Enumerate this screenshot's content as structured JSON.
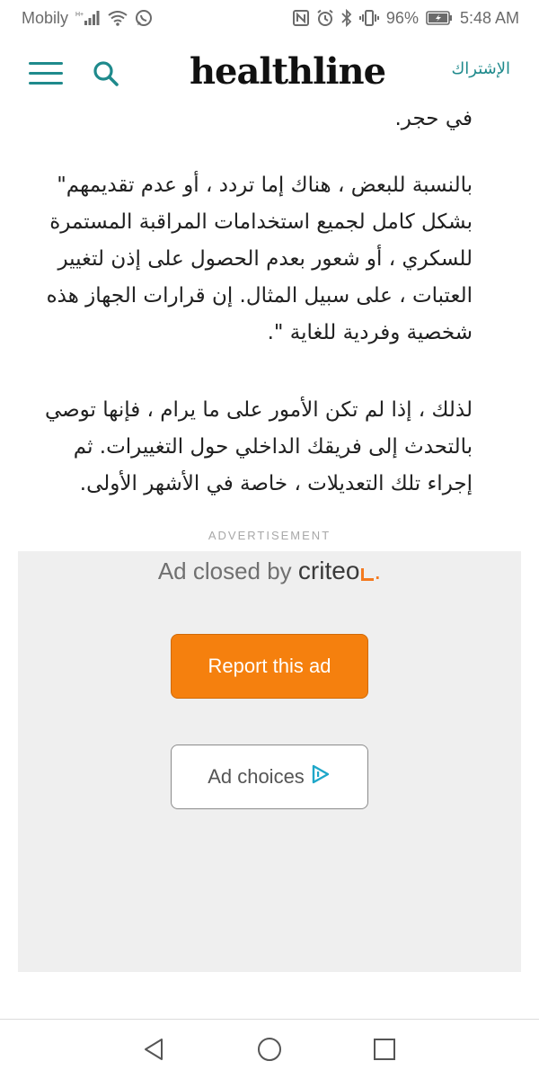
{
  "status_bar": {
    "carrier": "Mobily",
    "network": "H+",
    "battery_percent": "96%",
    "time": "5:48 AM",
    "icons": [
      "signal-icon",
      "wifi-icon",
      "whatsapp-icon",
      "nfc-icon",
      "alarm-icon",
      "bluetooth-icon",
      "vibrate-icon",
      "battery-icon"
    ]
  },
  "header": {
    "logo": "healthline",
    "subscribe_label": "الإشتراك",
    "accent_color": "#1f8a8c"
  },
  "article": {
    "paragraphs": [
      "في حجر.",
      "بالنسبة للبعض ، هناك إما تردد ، أو عدم تقديمهم\" بشكل كامل لجميع استخدامات المراقبة المستمرة للسكري ، أو شعور بعدم الحصول على إذن لتغيير العتبات ، على سبيل المثال. إن قرارات الجهاز هذه شخصية وفردية للغاية \".",
      "لذلك ، إذا لم تكن الأمور على ما يرام ، فإنها توصي بالتحدث إلى فريقك الداخلي حول التغييرات. ثم إجراء تلك التعديلات ، خاصة في الأشهر الأولى."
    ]
  },
  "ad": {
    "label": "ADVERTISEMENT",
    "closed_by": "Ad closed by",
    "brand": "criteo",
    "brand_color": "#f47a20",
    "report_label": "Report this ad",
    "report_color": "#f5800e",
    "choices_label": "Ad choices"
  },
  "nav_bar": {
    "buttons": [
      "back-icon",
      "home-icon",
      "recents-icon"
    ]
  }
}
